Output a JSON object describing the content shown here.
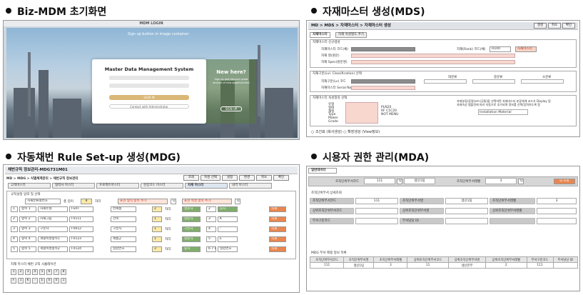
{
  "sections": {
    "s1": "Biz-MDM 초기화면",
    "s2": "자재마스터 생성(MDS)",
    "s3": "자동채번 Rule Set-up 생성(MDG)",
    "s4": "시용자 권한 관리(MDA)"
  },
  "login": {
    "topbar": "MDM LOGIN",
    "caption": "Sign up button in image container",
    "title": "Master Data Management System",
    "signin": "SIGN IN",
    "admin": "Contact with Administrator",
    "new_title": "New here?",
    "new_desc": "Sign up and discover great amount of new opportunities!",
    "signup": "SIGN UP"
  },
  "mds": {
    "breadcrumb": "MD > MDS > 자재마스터 > 자재마스터 생성",
    "buttons": [
      "생성",
      "취소",
      "확인"
    ],
    "tabs": [
      "자재마스터",
      "자재 속성별도 추가"
    ],
    "g1_title": "자재마스터 신규생성",
    "g1_labels": [
      "자재마스터 코드(채)",
      "자재 명(원문)",
      "자재 Spec(원문명)"
    ],
    "g1_right_label": "자재(Rank) 코드(채)",
    "g1_code": "H100",
    "g1_badge": "자재마스터",
    "g2_title": "자재구분(Lvl. Classification) 선택",
    "g2_labels": [
      "자재구분(Lv) 코드",
      "자재마스터 Serial No#"
    ],
    "g2_cols": [
      "대분류",
      "중분류",
      "소분류"
    ],
    "g3_title": "자재마스터 속성정의 선택",
    "g3_note1": "자재분류(증명)코드(공통)을 선택하면 자재마스터 분류체계 코드가 Display 됨",
    "g3_note2": "자재속성 템플릿에 따라 자동으로 추가되며 정보를 선택/입력하도록 함",
    "g3_rows": [
      "유형",
      "형태",
      "재질",
      "Type",
      "Maker",
      "Grade"
    ],
    "g3_codes": [
      "",
      "PLN20",
      "RF C1C20",
      "NOT MENU",
      ""
    ],
    "g3_inst": "Installation Material",
    "footer": "○ 조건표 (복사생성)    ○ 확장생성 (View정보)"
  },
  "mdg": {
    "header": "채번규칙 정보관리-MDG731M01",
    "breadcrumb": "MD > MDG > 식별체계관리 > 채번규칙 정보관리",
    "top_buttons": [
      "조회",
      "속성 선택",
      "설정",
      "변경",
      "취소",
      "확인"
    ],
    "tabs": [
      "고객마스터",
      "협력사 마스터",
      "프로젝트마스터",
      "현장코드 마스터",
      "자재 마스터",
      "내역 마스터"
    ],
    "section1": "규칙설정 입력 및 선택",
    "select_label": "자재분류별번호",
    "total_label": "총 길이",
    "total_val": "8",
    "digit": "자리",
    "hint1": "표현 형식 항목 추가",
    "hint2": "표현 속성 항목 추가",
    "rows": [
      {
        "num": "1",
        "item": "항목 1",
        "name": "자재유형",
        "code": "FERT",
        "type": "완제품",
        "len": "2",
        "kind": "영문자",
        "n2": "2",
        "kind2": "숫자"
      },
      {
        "num": "2",
        "item": "항목 2",
        "name": "자재그룹",
        "code": "F0111",
        "type": "건축",
        "len": "1",
        "kind": "영문자",
        "n2": "3",
        "kind2": "K"
      },
      {
        "num": "3",
        "item": "항목 3",
        "name": "구분자",
        "code": "F0012",
        "type": "구분자",
        "len": "1",
        "kind": "구분자",
        "n2": "4",
        "kind2": "-"
      },
      {
        "num": "4",
        "item": "항목 4",
        "name": "개별속성항목1",
        "code": "F0123",
        "type": "제품군",
        "len": "1",
        "kind": "영문자",
        "n2": "5",
        "kind2": "E"
      },
      {
        "num": "5",
        "item": "항목 5",
        "name": "개별속성항목2",
        "code": "F0124",
        "type": "일련번호",
        "len": "3",
        "kind": "숫자",
        "n2": "6 7 8",
        "kind2": "일련번호"
      }
    ],
    "delete": "삭제",
    "section2": "자재 마스터 채번 규칙 시뮬레이션",
    "sim_nums": [
      "1",
      "2",
      "3",
      "4",
      "5",
      "6",
      "7",
      "8"
    ],
    "sim_vals": [
      "F",
      "1",
      "K",
      "-",
      "E",
      "0",
      "0",
      "1"
    ]
  },
  "mda": {
    "title": "일반데이터",
    "top_label1": "조직단위부서코드",
    "top_val1": "111",
    "top_val2": "생산1팀",
    "top_label2": "조직단위부서레벨",
    "top_val3": "3",
    "search": "Q 조회",
    "detail_title": "조직단위부서 상세조회",
    "detail": [
      [
        "조직단위부서코드",
        "111",
        "조직단위부서명",
        "생산1팀",
        "조직단위부서레벨",
        "3"
      ],
      [
        "상위조직단위부서코드",
        "",
        "상위조직단위부서명",
        "",
        "상위조직단위부서레벨",
        ""
      ],
      [
        "부서구분코드",
        "",
        "부서담당 ID",
        "",
        "",
        ""
      ]
    ],
    "list_title": "MDG 부서 매핑 정보 목록",
    "list_headers": [
      "조직단위부서코드",
      "조직단위부서명",
      "조직단위부서레벨",
      "상위조직단위부서코드",
      "상위조직단위부서명",
      "상위조직단위부서레벨",
      "부서구분코드",
      "부서담당 ID"
    ],
    "list_row": [
      "111",
      "생산1팀",
      "3",
      "11",
      "생산본부",
      "2",
      "111",
      ""
    ]
  }
}
